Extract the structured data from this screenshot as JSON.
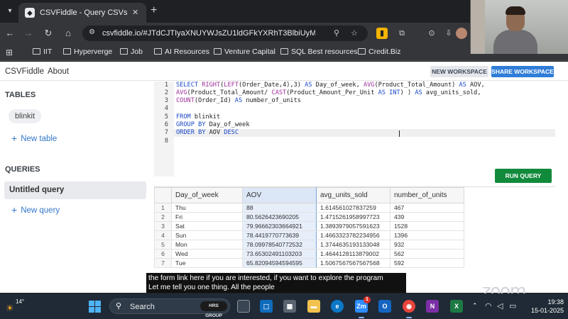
{
  "browser": {
    "tab_title": "CSVFiddle - Query CSVs with SQL",
    "tab_close": "✕",
    "new_tab": "+",
    "url": "csvfiddle.io/#JTdCJTIyaXNUYWJsZU1ldGFkYXRhT3BlbiUyMiUzQ...",
    "bookmarks": [
      "IIT",
      "Hyperverge",
      "Job",
      "AI Resources",
      "Venture Capital",
      "SQL Best resources",
      "Credit.Biz"
    ]
  },
  "app": {
    "brand": "CSVFiddle",
    "about": "About",
    "new_workspace": "NEW WORKSPACE",
    "share_workspace": "SHARE WORKSPACE",
    "sidebar": {
      "tables_heading": "TABLES",
      "tables": [
        "blinkit"
      ],
      "new_table": "New table",
      "queries_heading": "QUERIES",
      "queries": [
        "Untitled query"
      ],
      "new_query": "New query"
    },
    "editor": {
      "line_numbers": [
        "1",
        "2",
        "3",
        "4",
        "5",
        "6",
        "7",
        "8"
      ],
      "lines": [
        "SELECT RIGHT(LEFT(Order_Date,4),3) AS Day_of_week, AVG(Product_Total_Amount) AS AOV,",
        "AVG(Product_Total_Amount/ CAST(Product_Amount_Per_Unit AS INT) ) AS avg_units_sold,",
        "COUNT(Order_Id) AS number_of_units",
        "",
        "FROM blinkit",
        "GROUP BY Day_of_week",
        "ORDER BY AOV DESC",
        ""
      ],
      "run_label": "RUN QUERY"
    },
    "results": {
      "columns": [
        "Day_of_week",
        "AOV",
        "avg_units_sold",
        "number_of_units"
      ],
      "rows": [
        [
          "1",
          "Thu",
          "88",
          "1.614561027837259",
          "467"
        ],
        [
          "2",
          "Fri",
          "80.5626423690205",
          "1.4715261958997723",
          "439"
        ],
        [
          "3",
          "Sat",
          "79.96662303664921",
          "1.3893979057591623",
          "1528"
        ],
        [
          "4",
          "Sun",
          "78.4419770773639",
          "1.4663323782234956",
          "1396"
        ],
        [
          "5",
          "Mon",
          "78.09978540772532",
          "1.3744635193133048",
          "932"
        ],
        [
          "6",
          "Wed",
          "73.65302491103203",
          "1.4644128113879002",
          "562"
        ],
        [
          "7",
          "Tue",
          "65.82094594594595",
          "1.5067567567567568",
          "592"
        ]
      ]
    }
  },
  "captions": {
    "line1": "the form link here if you are interested, if you want to explore the program",
    "line2": "Let me tell you one thing. All the people"
  },
  "zoom_logo": "zoom",
  "taskbar": {
    "temperature": "14°",
    "search_text": "Search",
    "search_badge": "HRS GROUP",
    "zm_badge": "Zm",
    "zm_count": "1",
    "time": "19:38",
    "date": "15-01-2025"
  },
  "colors": {
    "accent_blue": "#2f7dd8",
    "run_green": "#128a3c",
    "keyword_blue": "#1a49c9"
  }
}
